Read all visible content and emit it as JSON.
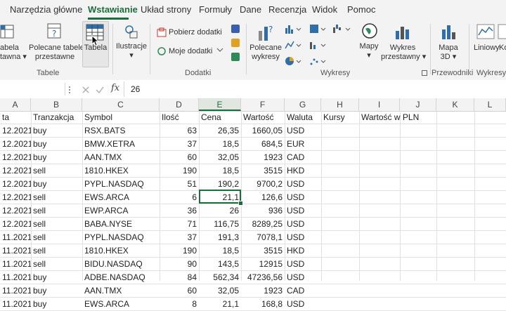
{
  "tabs": [
    "Narzędzia główne",
    "Wstawianie",
    "Układ strony",
    "Formuły",
    "Dane",
    "Recenzja",
    "Widok",
    "Pomoc"
  ],
  "ribbon": {
    "tabela_przestawna": [
      "abela",
      "tawna ▾"
    ],
    "polecane": [
      "Polecane tabele",
      "przestawne"
    ],
    "tabela": "Tabela",
    "ilustracje": [
      "Ilustracje",
      "▾"
    ],
    "pobierz": "Pobierz dodatki",
    "moje": "Moje dodatki",
    "polecane_wykresy": [
      "Polecane",
      "wykresy"
    ],
    "mapy": [
      "Mapy",
      "▾"
    ],
    "wykres_przestawny": [
      "Wykres",
      "przestawny ▾"
    ],
    "mapa3d": [
      "Mapa",
      "3D ▾"
    ],
    "liniowy": "Liniowy",
    "ko": "Ko",
    "groups": [
      "Tabele",
      "Dodatki",
      "Wykresy",
      "Przewodniki",
      "Wykresy p"
    ]
  },
  "formula_bar": {
    "value": "26",
    "fx": "fx"
  },
  "columns": [
    "A",
    "B",
    "C",
    "D",
    "E",
    "F",
    "G",
    "H",
    "I",
    "J",
    "K",
    "L"
  ],
  "headers": [
    "ta",
    "Tranzakcja",
    "Symbol",
    "Ilość",
    "Cena",
    "Wartość",
    "Waluta",
    "Kursy",
    "Wartość w PLN"
  ],
  "rows": [
    [
      "12.2021",
      "buy",
      "RSX.BATS",
      "63",
      "26,35",
      "1660,05",
      "USD"
    ],
    [
      "12.2021",
      "buy",
      "BMW.XETRA",
      "37",
      "18,5",
      "684,5",
      "EUR"
    ],
    [
      "12.2021",
      "buy",
      "AAN.TMX",
      "60",
      "32,05",
      "1923",
      "CAD"
    ],
    [
      "12.2021",
      "sell",
      "1810.HKEX",
      "190",
      "18,5",
      "3515",
      "HKD"
    ],
    [
      "12.2021",
      "buy",
      "PYPL.NASDAQ",
      "51",
      "190,2",
      "9700,2",
      "USD"
    ],
    [
      "12.2021",
      "sell",
      "EWS.ARCA",
      "6",
      "21,1",
      "126,6",
      "USD"
    ],
    [
      "12.2021",
      "sell",
      "EWP.ARCA",
      "36",
      "26",
      "936",
      "USD"
    ],
    [
      "12.2021",
      "sell",
      "BABA.NYSE",
      "71",
      "116,75",
      "8289,25",
      "USD"
    ],
    [
      "11.2021",
      "sell",
      "PYPL.NASDAQ",
      "37",
      "191,3",
      "7078,1",
      "USD"
    ],
    [
      "11.2021",
      "sell",
      "1810.HKEX",
      "190",
      "18,5",
      "3515",
      "HKD"
    ],
    [
      "11.2021",
      "sell",
      "BIDU.NASDAQ",
      "90",
      "143,5",
      "12915",
      "USD"
    ],
    [
      "11.2021",
      "buy",
      "ADBE.NASDAQ",
      "84",
      "562,34",
      "47236,56",
      "USD"
    ],
    [
      "11.2021",
      "buy",
      "AAN.TMX",
      "60",
      "32,05",
      "1923",
      "CAD"
    ],
    [
      "11.2021",
      "buy",
      "EWS.ARCA",
      "8",
      "21,1",
      "168,8",
      "USD"
    ]
  ]
}
